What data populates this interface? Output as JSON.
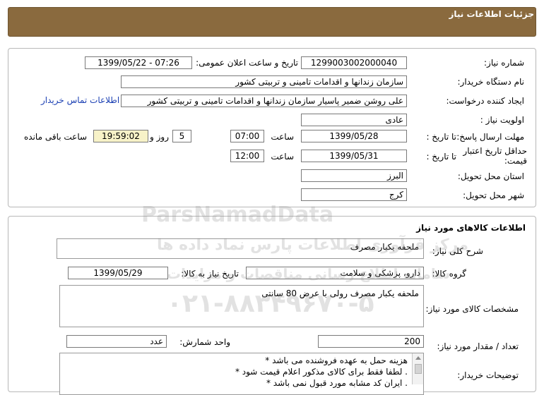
{
  "header": {
    "title": "جزئیات اطلاعات نیاز"
  },
  "need_info": {
    "need_number_label": "شماره نیاز:",
    "need_number": "1299003002000040",
    "announce_label": "تاریخ و ساعت اعلان عمومی:",
    "announce_value": "1399/05/22 - 07:26",
    "buyer_org_label": "نام دستگاه خریدار:",
    "buyer_org": "سازمان زندانها و اقدامات تامینی و تربیتی کشور",
    "requester_label": "ایجاد کننده درخواست:",
    "requester": "علی روشن ضمیر پاسیار سازمان زندانها و اقدامات تامینی و تربیتی کشور",
    "contact_link": "اطلاعات تماس خریدار",
    "priority_label": "اولویت نیاز :",
    "priority": "عادی",
    "deadline_label": "مهلت ارسال پاسخ:",
    "to_date_label": "تا تاریخ :",
    "deadline_date": "1399/05/28",
    "time_label": "ساعت",
    "deadline_time": "07:00",
    "days_value": "5",
    "days_label": "روز و",
    "remaining_time": "19:59:02",
    "remaining_label": "ساعت باقی مانده",
    "validity_label": "حداقل تاریخ اعتبار قیمت:",
    "validity_to_label": "تا تاریخ :",
    "validity_date": "1399/05/31",
    "validity_time_label": "ساعت",
    "validity_time": "12:00",
    "province_label": "استان محل تحویل:",
    "province": "البرز",
    "city_label": "شهر محل تحویل:",
    "city": "کرج"
  },
  "goods": {
    "section_title": "اطلاعات کالاهای مورد نیاز",
    "summary_label": "شرح کلی نیاز:",
    "summary": "ملحفه یکبار مصرف",
    "group_label": "گروه کالا:",
    "group": "دارو، پزشکی و سلامت",
    "need_date_label": "تاریخ نیاز به کالا:",
    "need_date": "1399/05/29",
    "specs_label": "مشخصات کالای مورد نیاز:",
    "specs": "ملحفه یکبار مصرف رولی با عرض 80 سانتی",
    "qty_label": "تعداد / مقدار مورد نیاز:",
    "qty": "200",
    "unit_label": "واحد شمارش:",
    "unit": "عدد",
    "buyer_notes_label": "توضیحات خریدار:",
    "notes": [
      "هزینه حمل به عهده فروشنده می باشد *",
      ". لطفا فقط برای کالای مذکور اعلام قیمت شود *",
      ". ایران کد مشابه مورد قبول نمی باشد *"
    ]
  },
  "watermark": {
    "brand": "ParsNamadData",
    "persian": "مرکز فرآوری اطلاعات پارس نماد داده ها",
    "persian2": "سامانه اطلاع رسانی مناقصات و مزایدات",
    "phone": "۰۲۱-۸۸۳۴۹۶۷۰-۵"
  },
  "colors": {
    "header_bg": "#8a6a3e",
    "link": "#1a3fb3",
    "remaining_bg": "#f7f2c8"
  }
}
